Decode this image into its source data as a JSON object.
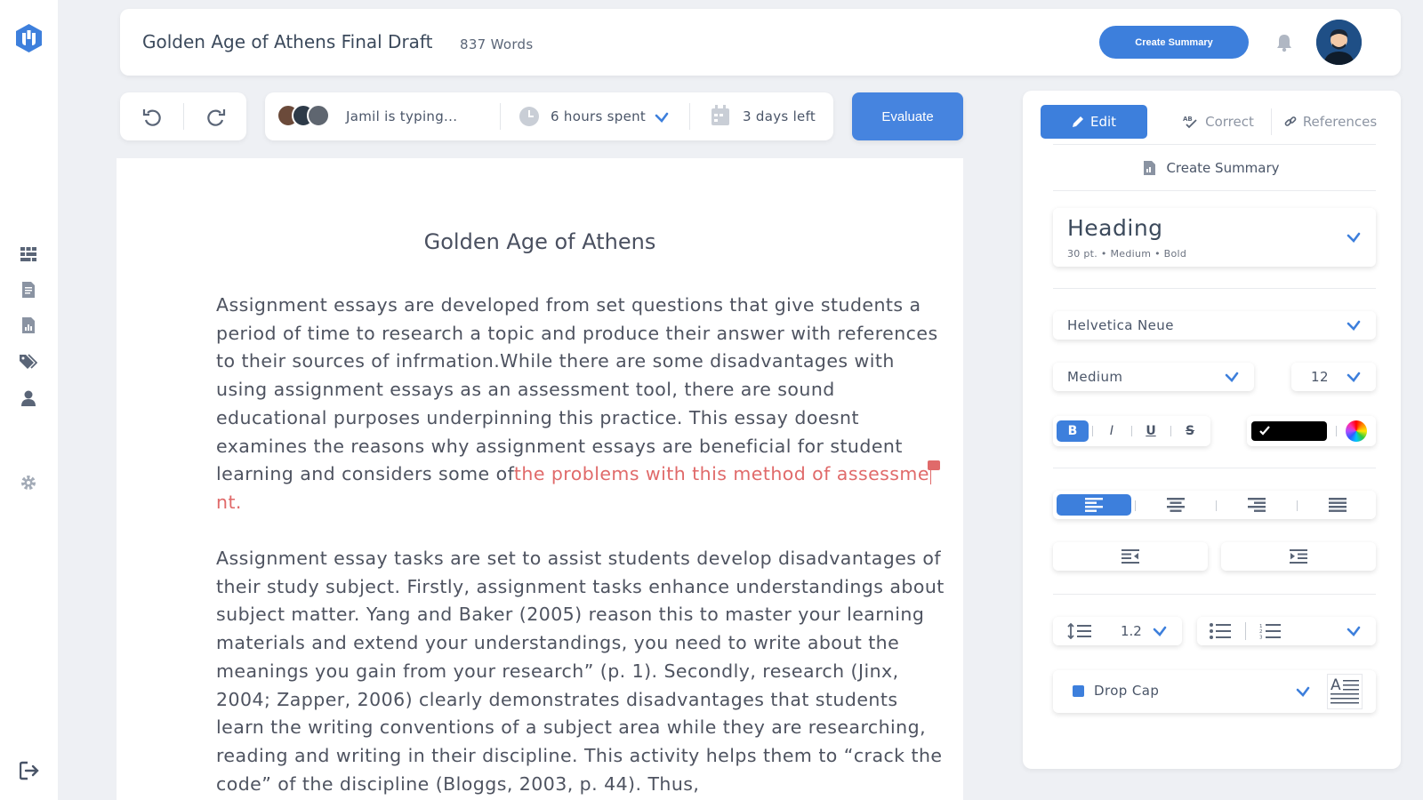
{
  "header": {
    "doc_title": "Golden Age of Athens Final Draft",
    "word_count": "837 Words",
    "create_summary_label": "Create Summary"
  },
  "sidebar": {
    "items": [
      {
        "icon": "dashboard-grid-icon"
      },
      {
        "icon": "document-icon"
      },
      {
        "icon": "document-chart-icon"
      },
      {
        "icon": "tags-icon"
      },
      {
        "icon": "user-icon"
      },
      {
        "icon": "settings-icon"
      }
    ],
    "logout_icon": "logout-icon"
  },
  "toolbar": {
    "typing_status": "Jamil is typing...",
    "time_spent": "6 hours spent",
    "days_left": "3 days left",
    "evaluate_label": "Evaluate"
  },
  "document": {
    "title": "Golden Age of Athens",
    "para1_text": "Assignment essays are developed from set questions that give students a period of time to research a topic and produce their answer with references to their sources of infrmation.While there are some disadvantages with using assignment essays as an assessment tool, there are sound educational purposes underpinning this practice. This essay doesnt examines the reasons why assignment essays are beneficial for student learning and considers some of",
    "para1_highlight_a": "the problems with this method of assessme",
    "para1_highlight_b": "nt.",
    "para2_text": "Assignment essay tasks are set to assist students develop disadvantages of their study subject. Firstly, assignment tasks enhance understandings about subject matter. Yang and Baker (2005) reason this to master your learning materials and extend your understandings, you need to write about the meanings you gain from your research” (p. 1). Secondly, research (Jinx, 2004; Zapper, 2006) clearly demonstrates disadvantages that students learn the writing conventions of a subject area while they are researching, reading and writing in their discipline. This activity helps them to “crack the code” of the discipline (Bloggs, 2003, p. 44). Thus,"
  },
  "panel": {
    "tabs": [
      "Edit",
      "Correct",
      "References"
    ],
    "create_summary": "Create Summary",
    "style_name": "Heading",
    "style_size": "30 pt.",
    "style_weight": "Medium",
    "style_bold": "Bold",
    "font_family": "Helvetica Neue",
    "font_weight": "Medium",
    "font_size": "12",
    "style_buttons": [
      "B",
      "I",
      "U",
      "S"
    ],
    "text_color": "#000000",
    "line_height": "1.2",
    "drop_cap_label": "Drop Cap"
  },
  "colors": {
    "accent": "#3d7fdc",
    "highlight": "#e06a6a"
  }
}
